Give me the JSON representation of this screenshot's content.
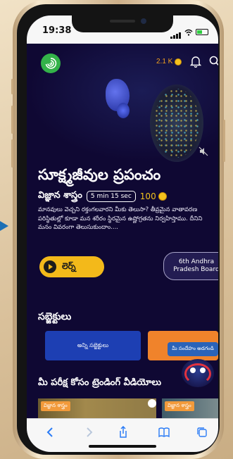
{
  "status_bar": {
    "time": "19:38"
  },
  "header": {
    "coins_label": "2.1 K",
    "icons": [
      "app-logo-icon",
      "coin-icon",
      "bell-icon",
      "search-icon"
    ]
  },
  "video": {
    "mute_icon": "mute-icon"
  },
  "lesson": {
    "title": "సూక్ష్మజీవుల ప్రపంచం",
    "subject": "విజ్ఞాన శాస్త్రం",
    "duration": "5 min 15 sec",
    "points": "100",
    "description": "మానవులు వెచ్చని రక్తంగలవారని మీకు తెలుసా? తీవ్రమైన వాతావరణ పరిస్థితుల్లో కూడా మన శరీరం స్థిరమైన ఉష్ణోగ్రతను నిర్వహిస్తాము. దీనిని మనం వివరంగా తెలుసుకుందాం....",
    "learn_label": "లెర్న్",
    "board_label_line1": "6th Andhra",
    "board_label_line2": "Pradesh Board"
  },
  "subjects": {
    "heading": "సబ్జెక్టులు",
    "all_subjects": "అన్ని సబ్జెక్టులు"
  },
  "helper": {
    "text": "మీ సందేహం అడగండి"
  },
  "trending": {
    "heading": "మీ పరీక్ష కోసం ట్రెండింగ్ వీడియోలు",
    "thumb_tags": [
      "విజ్ఞాన శాస్త్రం",
      "విజ్ఞాన శాస్త్రం"
    ]
  },
  "browser_toolbar": {
    "buttons": [
      "back-icon",
      "forward-icon",
      "share-icon",
      "bookmarks-icon",
      "tabs-icon"
    ]
  },
  "colors": {
    "background": "#0f0833",
    "accent_yellow": "#f3b91a",
    "logo_green": "#33b249",
    "subject_blue": "#1d3fb3"
  }
}
